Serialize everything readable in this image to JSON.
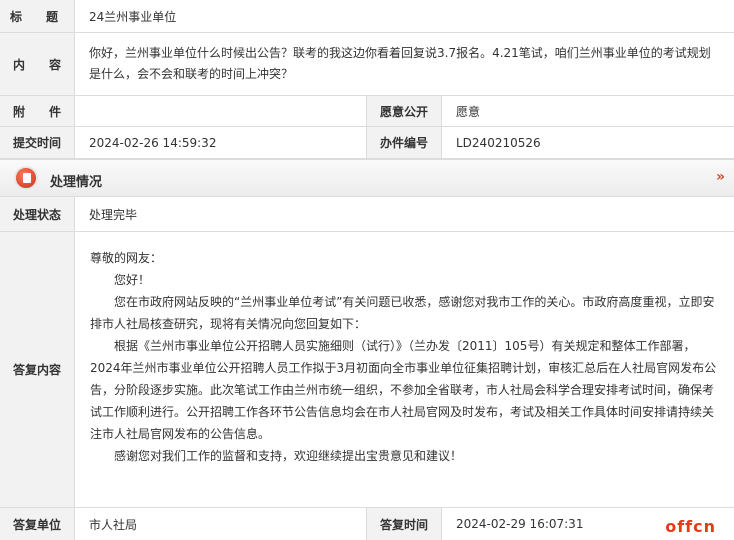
{
  "fields": {
    "title": {
      "label": "标　　题",
      "value": "24兰州事业单位"
    },
    "content": {
      "label": "内　　容",
      "value": "你好，兰州事业单位什么时候出公告？联考的我这边你看着回复说3.7报名。4.21笔试，咱们兰州事业单位的考试规划是什么，会不会和联考的时间上冲突？"
    },
    "attachment": {
      "label": "附　　件",
      "value": ""
    },
    "willing_public": {
      "label": "愿意公开",
      "value": "愿意"
    },
    "submit_time": {
      "label": "提交时间",
      "value": "2024-02-26 14:59:32"
    },
    "case_no": {
      "label": "办件编号",
      "value": "LD240210526"
    }
  },
  "section": {
    "title": "处理情况",
    "more": "»"
  },
  "status": {
    "label": "处理状态",
    "value": "处理完毕"
  },
  "reply": {
    "label": "答复内容",
    "paragraphs": [
      "尊敬的网友：",
      "您好！",
      "您在市政府网站反映的“兰州事业单位考试”有关问题已收悉，感谢您对我市工作的关心。市政府高度重视，立即安排市人社局核查研究，现将有关情况向您回复如下：",
      "根据《兰州市事业单位公开招聘人员实施细则（试行）》（兰办发〔2011〕105号）有关规定和整体工作部署，2024年兰州市事业单位公开招聘人员工作拟于3月初面向全市事业单位征集招聘计划，审核汇总后在人社局官网发布公告，分阶段逐步实施。此次笔试工作由兰州市统一组织，不参加全省联考，市人社局会科学合理安排考试时间，确保考试工作顺利进行。公开招聘工作各环节公告信息均会在市人社局官网及时发布，考试及相关工作具体时间安排请持续关注市人社局官网发布的公告信息。",
      "感谢您对我们工作的监督和支持，欢迎继续提出宝贵意见和建议！"
    ]
  },
  "reply_unit": {
    "label": "答复单位",
    "value": "市人社局"
  },
  "reply_time": {
    "label": "答复时间",
    "value": "2024-02-29 16:07:31"
  },
  "watermark": "offcn"
}
